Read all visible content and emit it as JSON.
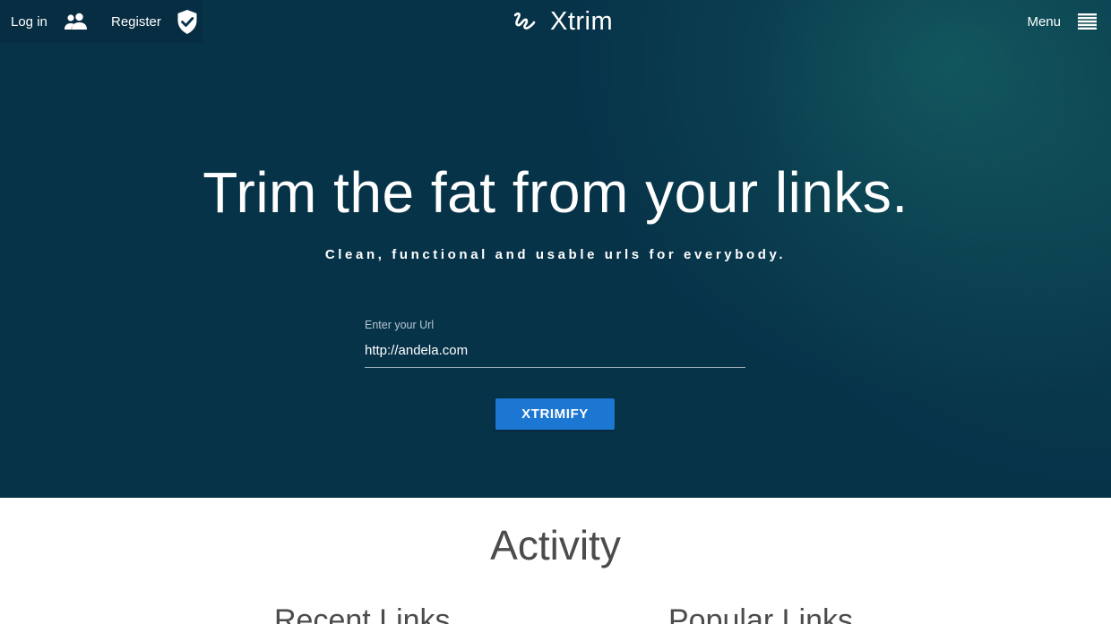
{
  "nav": {
    "login_label": "Log in",
    "register_label": "Register",
    "menu_label": "Menu",
    "icons": {
      "login": "users-icon",
      "register": "shield-check-icon",
      "menu": "hamburger-icon",
      "brand": "logo-icon"
    }
  },
  "brand": {
    "name": "Xtrim"
  },
  "hero": {
    "headline": "Trim the fat from your links.",
    "tagline": "Clean, functional and usable urls for everybody.",
    "url_label": "Enter your Url",
    "url_value": "http://andela.com",
    "button_label": "XTRIMIFY"
  },
  "activity": {
    "title": "Activity",
    "recent_heading": "Recent Links",
    "popular_heading": "Popular Links"
  },
  "colors": {
    "hero_background": "#073349",
    "accent_button": "#1b77d2",
    "text_dark": "#4c4c4c"
  }
}
